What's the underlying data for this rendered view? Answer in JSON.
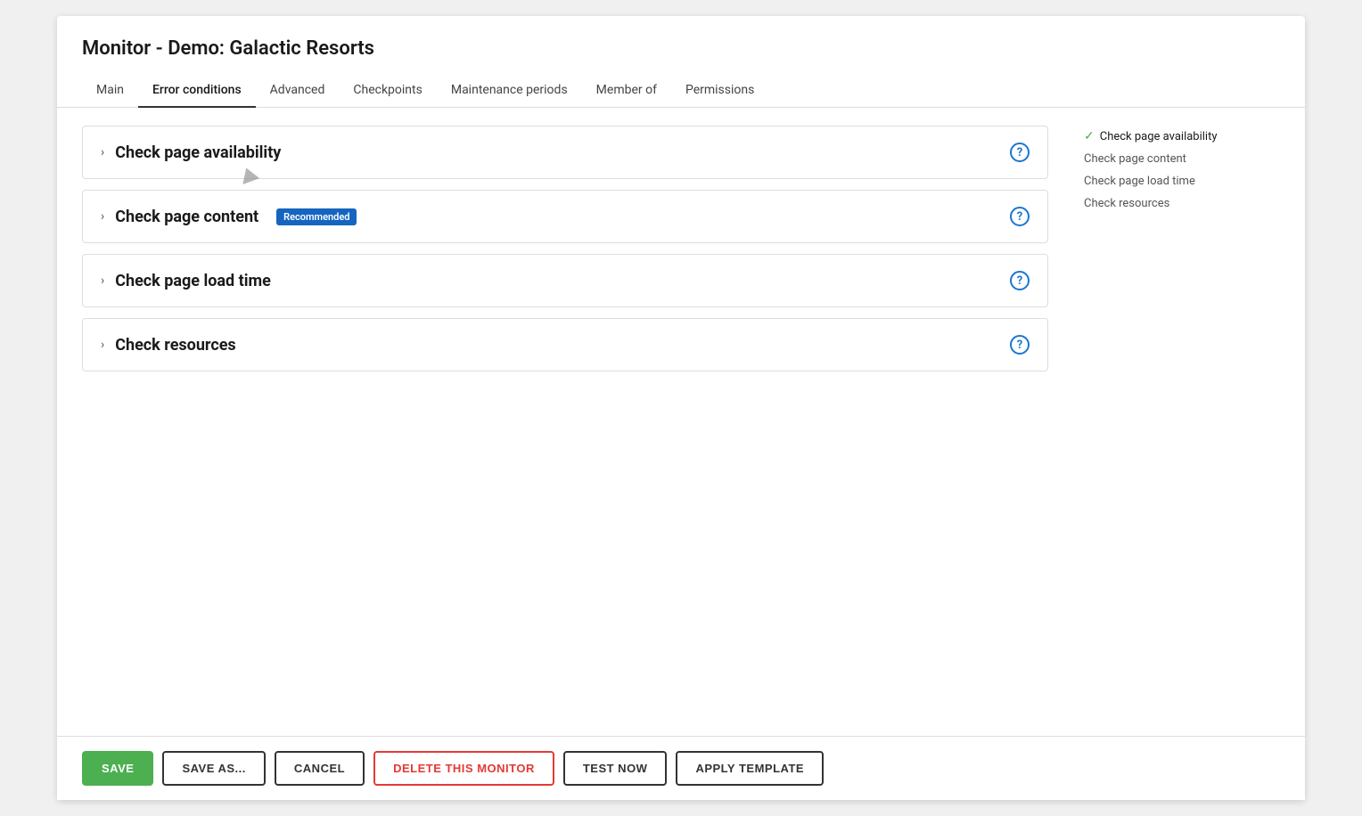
{
  "window": {
    "title": "Monitor - Demo: Galactic Resorts"
  },
  "tabs": [
    {
      "id": "main",
      "label": "Main",
      "active": false
    },
    {
      "id": "error-conditions",
      "label": "Error conditions",
      "active": true
    },
    {
      "id": "advanced",
      "label": "Advanced",
      "active": false
    },
    {
      "id": "checkpoints",
      "label": "Checkpoints",
      "active": false
    },
    {
      "id": "maintenance-periods",
      "label": "Maintenance periods",
      "active": false
    },
    {
      "id": "member-of",
      "label": "Member of",
      "active": false
    },
    {
      "id": "permissions",
      "label": "Permissions",
      "active": false
    }
  ],
  "accordion": [
    {
      "id": "check-page-availability",
      "title": "Check page availability",
      "badge": null,
      "active": true
    },
    {
      "id": "check-page-content",
      "title": "Check page content",
      "badge": "Recommended",
      "active": false
    },
    {
      "id": "check-page-load-time",
      "title": "Check page load time",
      "badge": null,
      "active": false
    },
    {
      "id": "check-resources",
      "title": "Check resources",
      "badge": null,
      "active": false
    }
  ],
  "sidebar": {
    "items": [
      {
        "label": "Check page availability",
        "active": true
      },
      {
        "label": "Check page content",
        "active": false
      },
      {
        "label": "Check page load time",
        "active": false
      },
      {
        "label": "Check resources",
        "active": false
      }
    ]
  },
  "footer": {
    "save_label": "SAVE",
    "save_as_label": "SAVE AS...",
    "cancel_label": "CANCEL",
    "delete_label": "DELETE THIS MONITOR",
    "test_label": "TEST NOW",
    "apply_template_label": "APPLY TEMPLATE"
  }
}
